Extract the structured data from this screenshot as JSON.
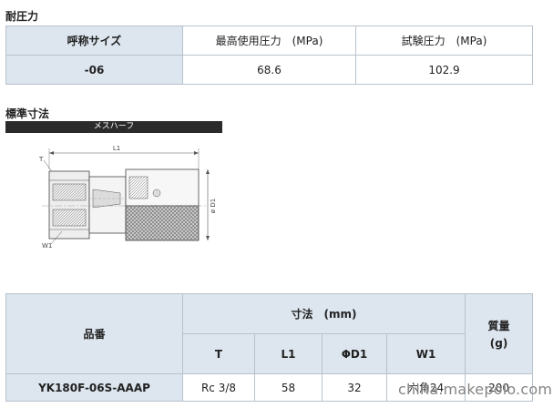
{
  "pressure": {
    "title": "耐圧力",
    "headers": [
      "呼称サイズ",
      "最高使用圧力　(MPa)",
      "試験圧力　(MPa)"
    ],
    "row": [
      "-06",
      "68.6",
      "102.9"
    ]
  },
  "dimensions": {
    "title": "標準寸法",
    "drawing_caption": "メスハーフ",
    "labels": {
      "t": "T",
      "l1": "L1",
      "d1": "ø D1",
      "w1": "W1"
    }
  },
  "spec_table": {
    "col_part": "品番",
    "col_dims": "寸法　(mm)",
    "col_mass_1": "質量",
    "col_mass_2": "(g)",
    "sub_headers": [
      "T",
      "L1",
      "ΦD1",
      "W1"
    ],
    "row": {
      "part": "YK180F-06S-AAAP",
      "t": "Rc 3/8",
      "l1": "58",
      "d1": "32",
      "w1": "六角24",
      "mass": "200"
    }
  },
  "watermark": "china.makepolo.com"
}
